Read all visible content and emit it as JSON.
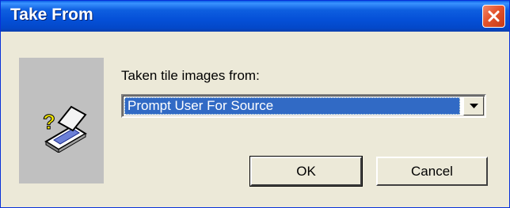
{
  "window": {
    "title": "Take From",
    "close_icon": "close-icon"
  },
  "panel": {
    "icon": "scanner-question-icon",
    "background": "#c0c0c0"
  },
  "source": {
    "label": "Taken tile images from:",
    "selected_value": "Prompt User For Source",
    "dropdown_icon": "chevron-down-icon"
  },
  "buttons": {
    "ok_label": "OK",
    "cancel_label": "Cancel"
  },
  "colors": {
    "titlebar": "#0550d8",
    "selection": "#316ac5",
    "dialog_bg": "#ece9d8",
    "close": "#e4532c"
  }
}
